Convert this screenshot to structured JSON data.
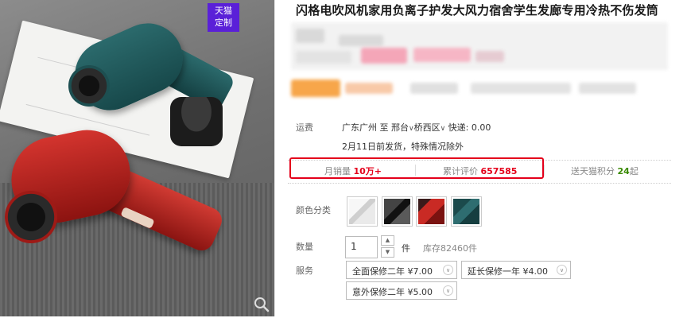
{
  "badge": {
    "line1": "天猫",
    "line2": "定制"
  },
  "product": {
    "title": "闪格电吹风机家用负离子护发大风力宿舍学生发廊专用冷热不伤发筒"
  },
  "shipping": {
    "label": "运费",
    "from": "广东广州",
    "to_word": "至",
    "city": "邢台",
    "district": "桥西区",
    "fee_label": "快递:",
    "fee": "0.00",
    "date": "2月11日前发货，特殊情况除外"
  },
  "stats": {
    "monthly_label": "月销量",
    "monthly_value": "10万+",
    "reviews_label": "累计评价",
    "reviews_value": "657585",
    "points_label": "送天猫积分",
    "points_value": "24",
    "points_suffix": "起",
    "accent_color": "#e4001b",
    "points_color": "#3a8a00"
  },
  "color_option": {
    "label": "颜色分类",
    "swatches": [
      "white",
      "black",
      "red",
      "green"
    ]
  },
  "quantity": {
    "label": "数量",
    "value": "1",
    "unit": "件",
    "stock": "库存82460件"
  },
  "service": {
    "label": "服务",
    "options": [
      {
        "name": "全面保修二年",
        "price": "¥7.00"
      },
      {
        "name": "延长保修一年",
        "price": "¥4.00"
      },
      {
        "name": "意外保修二年",
        "price": "¥5.00"
      }
    ]
  },
  "icons": {
    "zoom": "magnifier-icon",
    "dropdown": "chevron-down-icon"
  }
}
